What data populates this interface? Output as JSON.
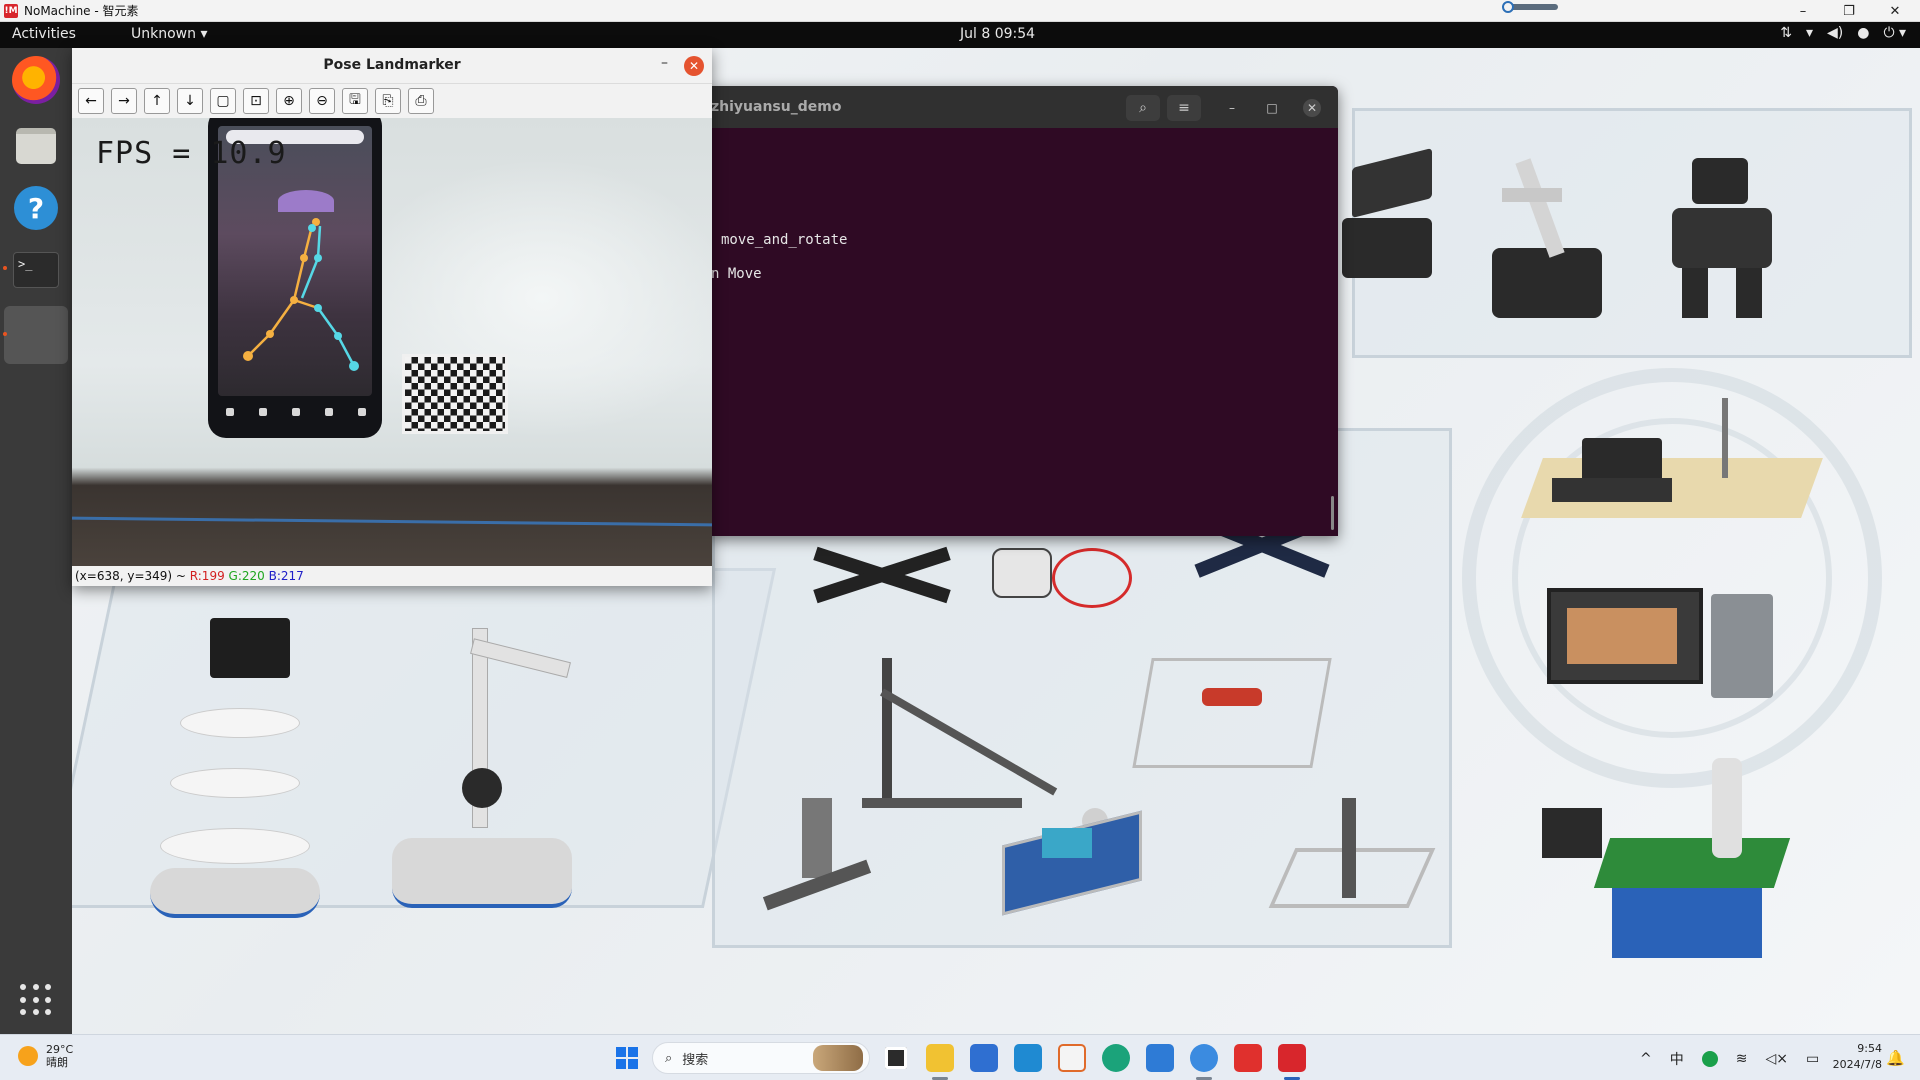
{
  "host": {
    "title": "NoMachine - 智元素",
    "app_icon_text": "!M",
    "minimize_glyph": "–",
    "maximize_glyph": "❐",
    "close_glyph": "✕"
  },
  "topbar": {
    "activities": "Activities",
    "app_menu": "Unknown ▾",
    "clock": "Jul 8  09:54",
    "tray_icons": [
      "network-wired-icon",
      "wifi-icon",
      "volume-icon",
      "microphone-icon",
      "power-icon"
    ]
  },
  "dock": {
    "items": [
      "firefox-icon",
      "files-icon",
      "help-icon",
      "terminal-icon"
    ],
    "help_glyph": "?",
    "terminal_glyph": ">_"
  },
  "terminal": {
    "title": "zhiyuansu_demo",
    "lines": [
      "move_and_rotate",
      "n Move"
    ],
    "search_glyph": "⌕",
    "menu_glyph": "≡",
    "minimize_glyph": "–",
    "maximize_glyph": "□",
    "close_glyph": "✕"
  },
  "pose_window": {
    "title": "Pose Landmarker",
    "minimize_glyph": "–",
    "close_glyph": "✕",
    "toolbar": [
      "←",
      "→",
      "↑",
      "↓",
      "▢",
      "⊡",
      "⊕",
      "⊖",
      "🖫",
      "⎘",
      "⎙"
    ],
    "fps_text": "FPS = 10.9",
    "status": {
      "coords": "(x=638, y=349) ~ ",
      "r": "R:199",
      "g": "G:220",
      "b": "B:217"
    }
  },
  "taskbar": {
    "weather_temp": "29°C",
    "weather_desc": "晴朗",
    "search_placeholder": "搜索",
    "search_glyph": "⌕",
    "tray": [
      "^",
      "中"
    ],
    "time": "9:54",
    "date": "2024/7/8",
    "bell_glyph": "🔔"
  },
  "colors": {
    "terminal_bg": "#2f0a24",
    "ubuntu_topbar": "#0c0c0c",
    "dock_bg": "#3a3a3a",
    "close_red": "#e5532f",
    "taskbar_bg": "#e7ecf3"
  }
}
